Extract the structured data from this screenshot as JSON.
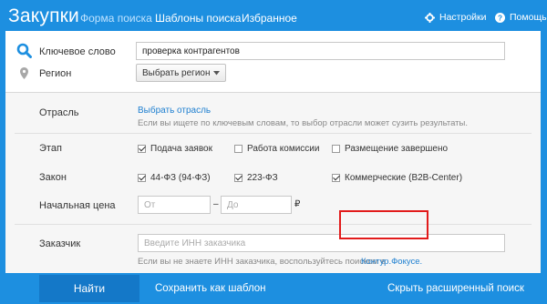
{
  "header": {
    "brand": "Закупки",
    "tabs": [
      "Форма поиска",
      "Шаблоны поиска",
      "Избранное"
    ],
    "settings": "Настройки",
    "help": "Помощь"
  },
  "form": {
    "keyword_label": "Ключевое слово",
    "keyword_value": "проверка контрагентов",
    "region_label": "Регион",
    "region_select": "Выбрать регион",
    "industry_label": "Отрасль",
    "industry_link": "Выбрать отрасль",
    "industry_hint": "Если вы ищете по ключевым словам, то выбор отрасли может сузить результаты.",
    "stage_label": "Этап",
    "stage_options": [
      {
        "label": "Подача заявок",
        "checked": true
      },
      {
        "label": "Работа комиссии",
        "checked": false
      },
      {
        "label": "Размещение завершено",
        "checked": false
      }
    ],
    "law_label": "Закон",
    "law_options": [
      {
        "label": "44-ФЗ (94-ФЗ)",
        "checked": true
      },
      {
        "label": "223-ФЗ",
        "checked": true
      },
      {
        "label": "Коммерческие (B2B-Center)",
        "checked": true
      }
    ],
    "price_label": "Начальная цена",
    "price_from_placeholder": "От",
    "price_dash": "–",
    "price_to_placeholder": "До",
    "currency": "₽",
    "customer_label": "Заказчик",
    "customer_placeholder": "Введите ИНН заказчика",
    "customer_hint": "Если вы не знаете ИНН заказчика, воспользуйтесь поиском в",
    "customer_link": "Контур.Фокусе."
  },
  "footer": {
    "find": "Найти",
    "save_template": "Сохранить как шаблон",
    "hide_advanced": "Скрыть расширенный поиск"
  },
  "colors": {
    "accent": "#1d8fe0",
    "link": "#1e7fd0",
    "highlight": "#e21b1b"
  }
}
